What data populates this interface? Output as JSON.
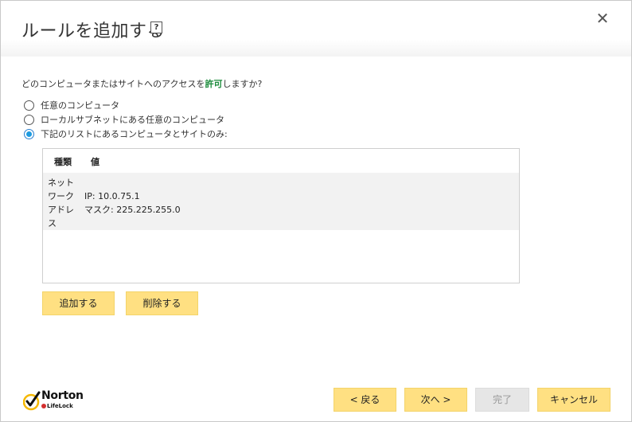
{
  "dialog": {
    "title": "ルールを追加する",
    "help_label": "?",
    "close_label": "✕"
  },
  "question": {
    "prefix": "どのコンピュータまたはサイトへのアクセスを",
    "highlight": "許可",
    "suffix": "しますか?"
  },
  "options": [
    {
      "label": "任意のコンピュータ",
      "checked": false
    },
    {
      "label": "ローカルサブネットにある任意のコンピュータ",
      "checked": false
    },
    {
      "label": "下記のリストにあるコンピュータとサイトのみ:",
      "checked": true
    }
  ],
  "list": {
    "columns": [
      "種類",
      "値"
    ],
    "rows": [
      {
        "type": "ネットワークアドレス",
        "value_line1": "IP: 10.0.75.1",
        "value_line2": "マスク: 225.225.255.0"
      }
    ]
  },
  "list_buttons": {
    "add": "追加する",
    "remove": "削除する"
  },
  "footer": {
    "logo_name": "Norton",
    "logo_sub": "LifeLock",
    "back": "< 戻る",
    "next": "次へ >",
    "finish": "完了",
    "cancel": "キャンセル",
    "finish_enabled": false
  },
  "colors": {
    "accent_button": "#ffe082",
    "highlight_text": "#1a8a3a",
    "radio_checked": "#1e9be0",
    "logo_check": "#f5b800"
  }
}
